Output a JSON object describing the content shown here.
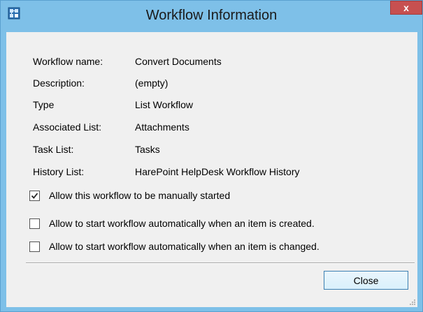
{
  "window": {
    "title": "Workflow Information",
    "close_glyph": "x",
    "app_icon": "workflow-app-icon"
  },
  "fields": [
    {
      "label": "Workflow name:",
      "value": "Convert Documents"
    },
    {
      "label": "Description:",
      "value": "(empty)"
    },
    {
      "label": "Type",
      "value": "List Workflow"
    },
    {
      "label": "Associated List:",
      "value": "Attachments"
    },
    {
      "label": "Task List:",
      "value": "Tasks"
    },
    {
      "label": "History List:",
      "value": "HarePoint HelpDesk Workflow History"
    }
  ],
  "options": [
    {
      "label": "Allow this workflow to be manually started",
      "checked": true
    },
    {
      "label": "Allow to start workflow automatically when an item is created.",
      "checked": false
    },
    {
      "label": "Allow to start workflow automatically when an item is changed.",
      "checked": false
    }
  ],
  "buttons": {
    "close_label": "Close"
  },
  "colors": {
    "frame": "#7ec0e8",
    "close_x": "#c75050",
    "client": "#f0f0f0"
  }
}
